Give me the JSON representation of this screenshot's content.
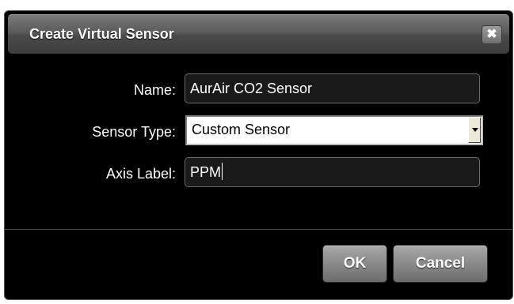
{
  "dialog": {
    "title": "Create Virtual Sensor",
    "close_glyph": "✖"
  },
  "form": {
    "name_label": "Name:",
    "name_value": "AurAir CO2 Sensor",
    "sensor_type_label": "Sensor Type:",
    "sensor_type_selected": "Custom Sensor",
    "axis_label_label": "Axis Label:",
    "axis_label_value": "PPM"
  },
  "buttons": {
    "ok": "OK",
    "cancel": "Cancel"
  },
  "icons": {
    "close": "close-icon",
    "dropdown": "chevron-down-icon"
  }
}
